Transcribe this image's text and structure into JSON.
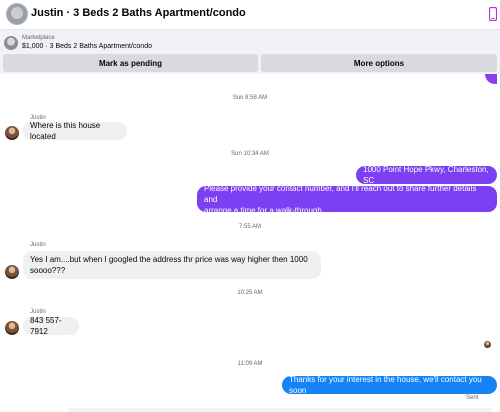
{
  "header": {
    "title": "Justin · 3 Beds 2 Baths Apartment/condo",
    "phone_icon": "phone-icon",
    "accent": "#b233d4"
  },
  "banner": {
    "label": "Marketplace",
    "listing": "$1,000 · 3 Beds 2 Baths Apartment/condo",
    "mark_pending": "Mark as pending",
    "more_options": "More options"
  },
  "messages": {
    "t1": "Sun 8:58 AM",
    "sender1": "Justin",
    "m1": "Where is this house located",
    "t2": "Sun 10:34 AM",
    "m2": "1000 Point Hope Pkwy, Charleston, SC",
    "m3_line1": "Please provide your contact number, and I'll reach out to share further details and",
    "m3_line2": "arrange a time for a walk-through",
    "t3": "7:55 AM",
    "sender2": "Justin",
    "m4_line1": "Yes I am....but when I googled the address thr price was way higher then 1000",
    "m4_line2": "soooo???",
    "t4": "10:25 AM",
    "sender3": "Justin",
    "m5": "843 557-7912",
    "t5": "11:09 AM",
    "m6": "Thanks for your interest in the house, we'll contact you soon",
    "status": "Sent"
  },
  "colors": {
    "outgoing_purple": "#7c3ff2",
    "outgoing_blue": "#1483f5",
    "incoming": "#f0f0f0"
  }
}
